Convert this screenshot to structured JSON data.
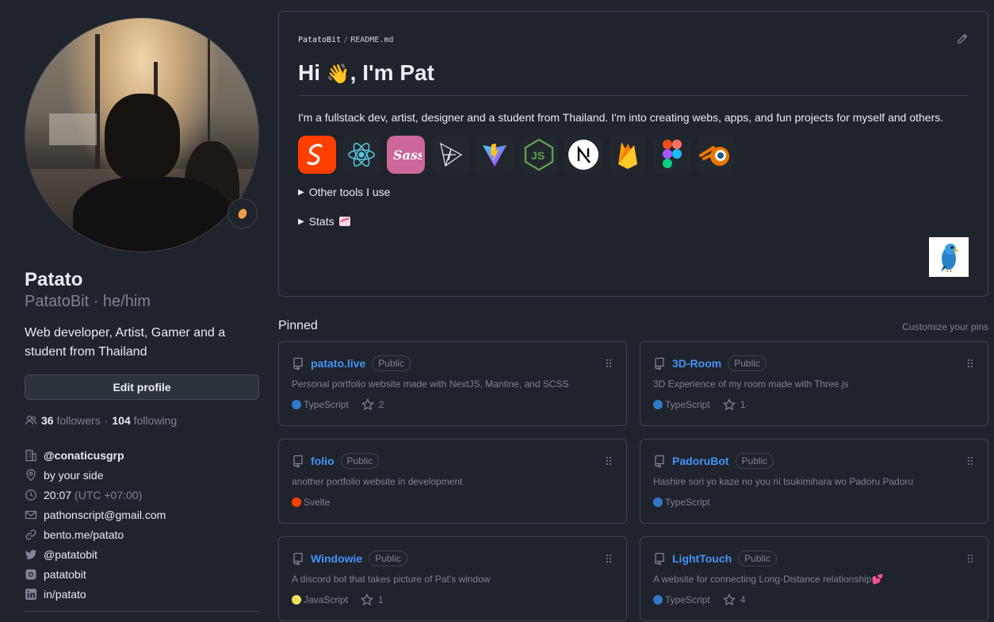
{
  "profile": {
    "name": "Patato",
    "login_line": "PatatoBit · he/him",
    "bio": "Web developer, Artist, Gamer and a student from Thailand",
    "edit_button": "Edit profile",
    "followers_count": "36",
    "followers_label": "followers",
    "separator": "·",
    "following_count": "104",
    "following_label": "following",
    "details": {
      "org": "@conaticusgrp",
      "location": "by your side",
      "time": "20:07",
      "timezone": "(UTC +07:00)",
      "email": "pathonscript@gmail.com",
      "website": "bento.me/patato",
      "twitter": "@patatobit",
      "instagram": "patatobit",
      "linkedin": "in/patato"
    }
  },
  "readme": {
    "owner": "PatatoBit",
    "file": "README.md",
    "heading_pre": "Hi",
    "heading_emoji": "👋",
    "heading_post": ", I'm Pat",
    "intro": "I'm a fullstack dev, artist, designer and a student from Thailand. I'm into creating webs, apps, and fun projects for myself and others.",
    "tech_icons": [
      "svelte-icon",
      "react-icon",
      "sass-icon",
      "threejs-icon",
      "vite-icon",
      "nodejs-icon",
      "nextjs-icon",
      "firebase-icon",
      "figma-icon",
      "blender-icon"
    ],
    "toggle_tools": "Other tools I use",
    "toggle_stats": "Stats"
  },
  "pinned": {
    "title": "Pinned",
    "customize": "Customize your pins",
    "repos": [
      {
        "name": "patato.live",
        "badge": "Public",
        "desc": "Personal portfolio website made with NextJS, Mantine, and SCSS",
        "lang": "TypeScript",
        "lang_color": "#3178c6",
        "stars": "2"
      },
      {
        "name": "3D-Room",
        "badge": "Public",
        "desc": "3D Experience of my room made with Three.js",
        "lang": "TypeScript",
        "lang_color": "#3178c6",
        "stars": "1"
      },
      {
        "name": "folio",
        "badge": "Public",
        "desc": "another portfolio website in development",
        "lang": "Svelte",
        "lang_color": "#ff3e00",
        "stars": ""
      },
      {
        "name": "PadoruBot",
        "badge": "Public",
        "desc": "Hashire sori yo kaze no you ni tsukimihara wo Padoru Padoru",
        "lang": "TypeScript",
        "lang_color": "#3178c6",
        "stars": ""
      },
      {
        "name": "Windowie",
        "badge": "Public",
        "desc": "A discord bot that takes picture of Pat's window",
        "lang": "JavaScript",
        "lang_color": "#f1e05a",
        "stars": "1"
      },
      {
        "name": "LightTouch",
        "badge": "Public",
        "desc": "A website for connecting Long-Distance relationship💕",
        "lang": "TypeScript",
        "lang_color": "#3178c6",
        "stars": "4"
      }
    ]
  }
}
